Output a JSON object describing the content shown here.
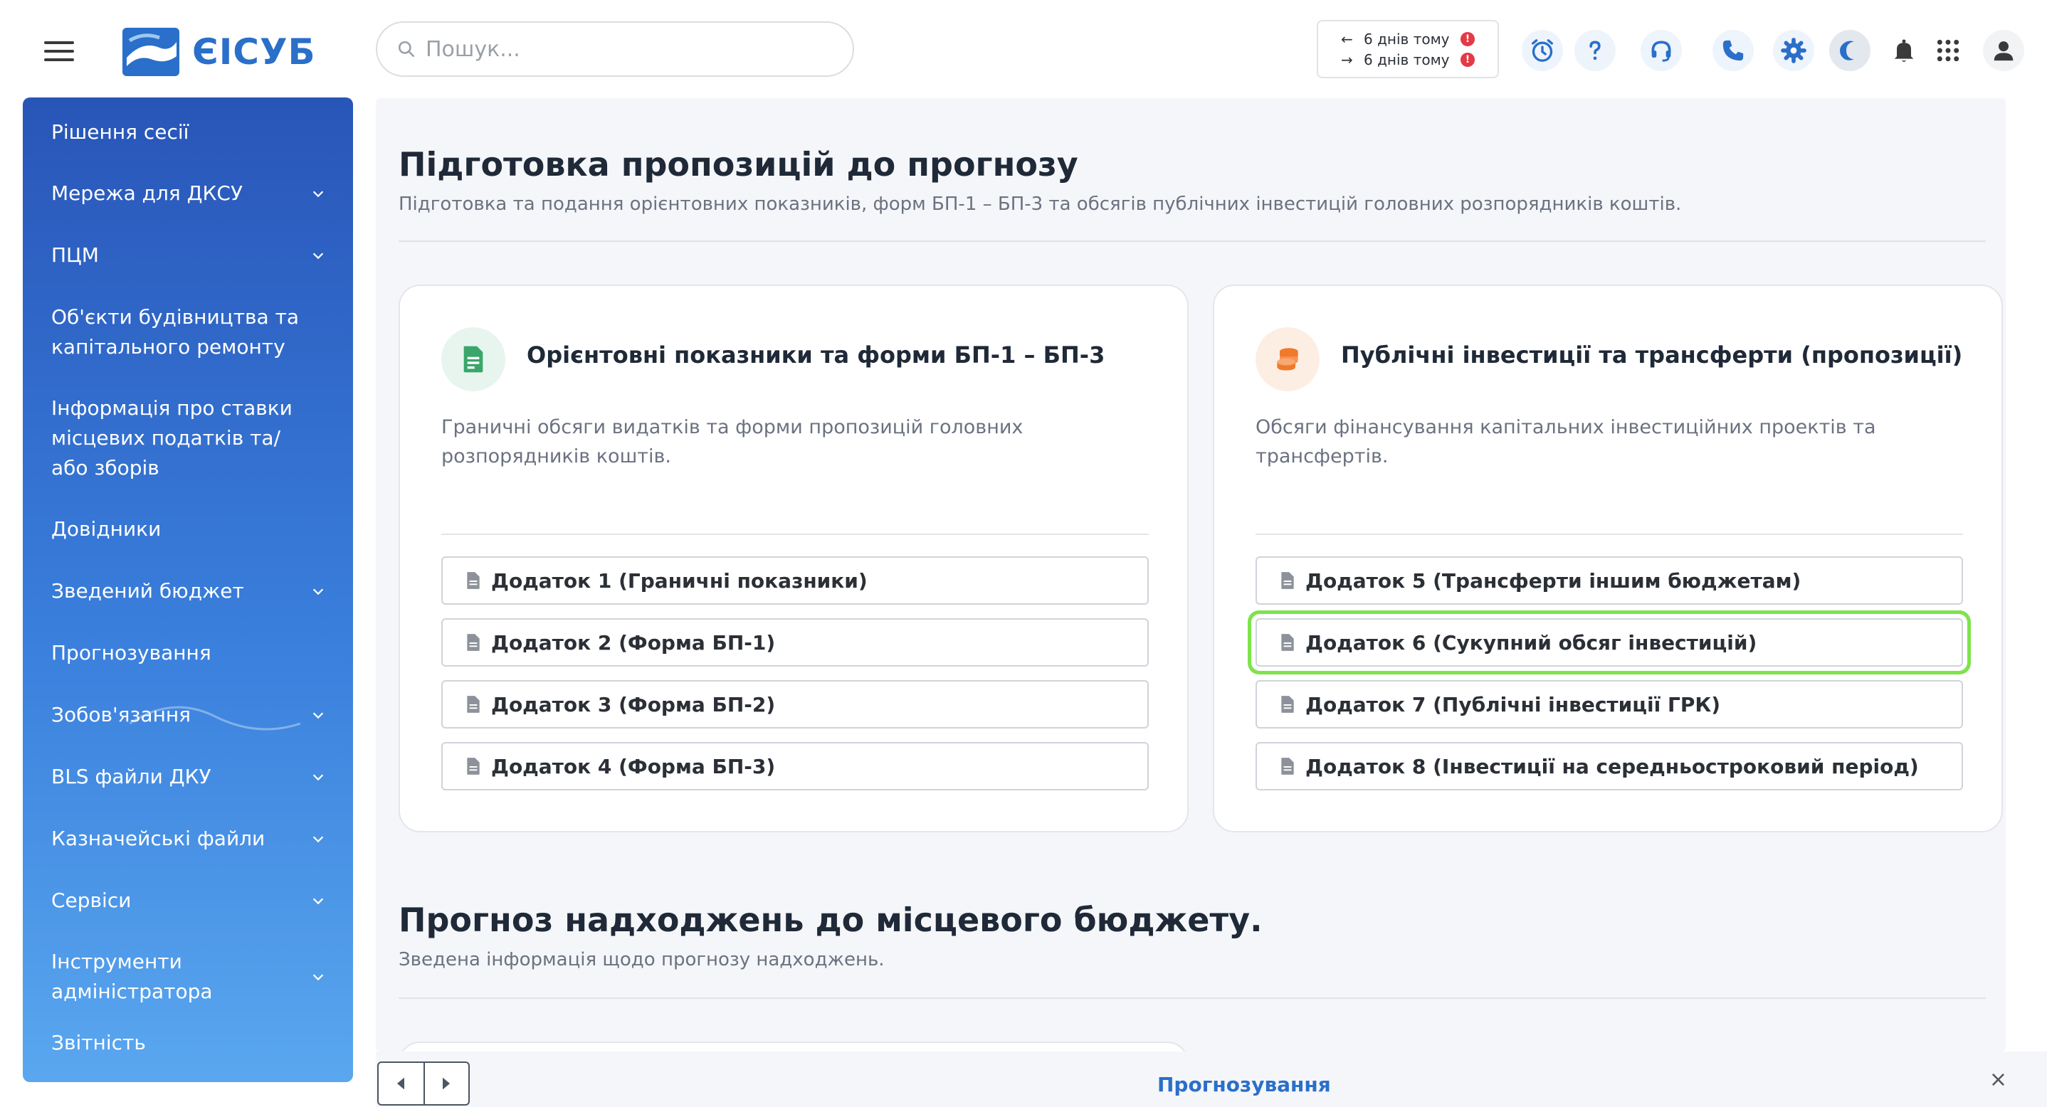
{
  "app": {
    "brand": "ЄІСУБ",
    "search_placeholder": "Пошук..."
  },
  "sync": {
    "rows": [
      {
        "direction": "←",
        "text": "6 днів тому",
        "badge": "!"
      },
      {
        "direction": "→",
        "text": "6 днів тому",
        "badge": "!"
      }
    ]
  },
  "toolbar_icons": [
    "alarm-clock-icon",
    "help-icon",
    "headset-icon",
    "phone-icon",
    "gear-icon",
    "moon-icon",
    "bell-icon",
    "apps-grid-icon",
    "user-icon"
  ],
  "sidebar": {
    "items": [
      {
        "label": "Рішення сесії",
        "has_children": false
      },
      {
        "label": "Мережа для ДКСУ",
        "has_children": true
      },
      {
        "label": "ПЦМ",
        "has_children": true
      },
      {
        "label": "Об'єкти будівництва та капітального ремонту",
        "has_children": false
      },
      {
        "label": "Інформація про ставки місцевих податків та/або зборів",
        "has_children": false
      },
      {
        "label": "Довідники",
        "has_children": false
      },
      {
        "label": "Зведений бюджет",
        "has_children": true
      },
      {
        "label": "Прогнозування",
        "has_children": false
      },
      {
        "label": "Зобов'язання",
        "has_children": true
      },
      {
        "label": "BLS файли ДКУ",
        "has_children": true
      },
      {
        "label": "Казначейські файли",
        "has_children": true
      },
      {
        "label": "Сервіси",
        "has_children": true
      },
      {
        "label": "Інструменти адміністратора",
        "has_children": true
      },
      {
        "label": "Звітність",
        "has_children": false
      }
    ]
  },
  "section1": {
    "title": "Підготовка пропозицій до прогнозу",
    "subtitle": "Підготовка та подання орієнтовних показників, форм БП-1 – БП-3 та обсягів публічних інвестицій головних розпорядників коштів."
  },
  "card1": {
    "title": "Орієнтовні показники та форми БП-1 – БП-3",
    "description": "Граничні обсяги видатків та форми пропозицій головних розпорядників коштів.",
    "links": [
      {
        "label": "Додаток 1 (Граничні показники)"
      },
      {
        "label": "Додаток 2 (Форма БП-1)"
      },
      {
        "label": "Додаток 3 (Форма БП-2)"
      },
      {
        "label": "Додаток 4 (Форма БП-3)"
      }
    ]
  },
  "card2": {
    "title": "Публічні інвестиції та трансферти (пропозиції)",
    "description": "Обсяги фінансування капітальних інвестиційних проектів та трансфертів.",
    "links": [
      {
        "label": "Додаток 5 (Трансферти іншим бюджетам)",
        "active": false
      },
      {
        "label": "Додаток 6 (Сукупний обсяг інвестицій)",
        "active": true
      },
      {
        "label": "Додаток 7 (Публічні інвестиції ГРК)",
        "active": false
      },
      {
        "label": "Додаток 8 (Інвестиції на середньостроковий період)",
        "active": false
      }
    ]
  },
  "section2": {
    "title": "Прогноз надходжень до місцевого бюджету.",
    "subtitle": "Зведена інформація щодо прогнозу надходжень."
  },
  "bottombar": {
    "tab_label": "Прогнозування",
    "close_symbol": "×"
  },
  "colors": {
    "accent": "#2a6fc9",
    "sidebar_top": "#2855b8",
    "sidebar_bottom": "#5aa7ef",
    "active_outline": "#7ee34d",
    "card1_icon_bg": "#e8f5ee",
    "card1_icon": "#3aa66a",
    "card2_icon_bg": "#fdeee4",
    "card2_icon": "#f07a2c"
  }
}
